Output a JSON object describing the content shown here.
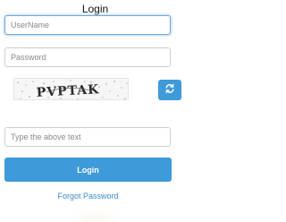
{
  "form": {
    "title": "Login",
    "username_placeholder": "UserName",
    "password_placeholder": "Password",
    "captcha_text": "PVPTAK",
    "captcha_answer_placeholder": "Type the above text",
    "login_label": "Login",
    "forgot_password_label": "Forgot Password"
  },
  "icons": {
    "refresh": "refresh-icon"
  },
  "colors": {
    "accent": "#3e9ad8",
    "link": "#3a8ccc",
    "focus_border": "#6ea8dc",
    "field_border": "#cfcfcf"
  }
}
